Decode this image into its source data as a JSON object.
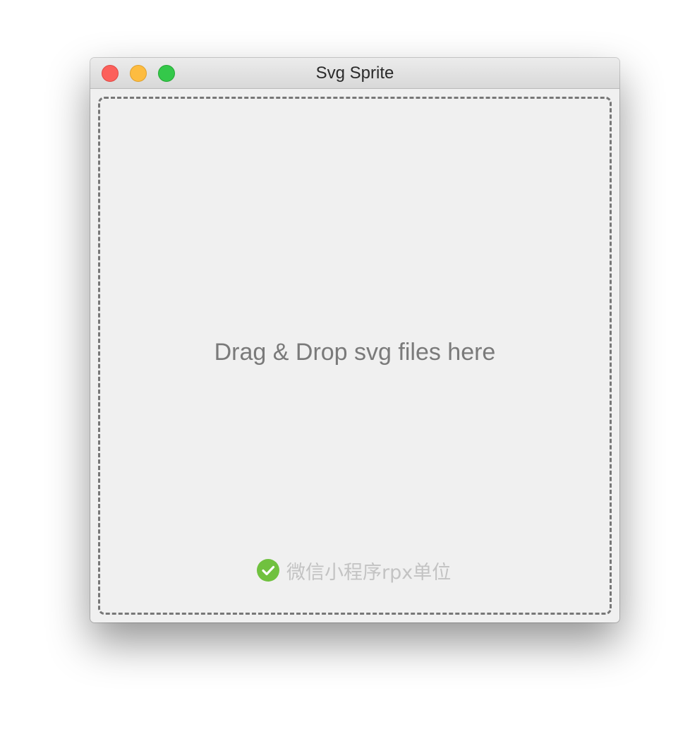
{
  "window": {
    "title": "Svg Sprite",
    "controls": [
      "close",
      "minimize",
      "maximize"
    ]
  },
  "dropzone": {
    "text": "Drag & Drop svg files here"
  },
  "options": {
    "rpx": {
      "label": "微信小程序rpx单位",
      "checked": true,
      "icon": "check-circle-icon",
      "color": "#70c13f"
    }
  },
  "colors": {
    "close": "#fc605b",
    "minimize": "#fdbc40",
    "maximize": "#34c84a"
  }
}
